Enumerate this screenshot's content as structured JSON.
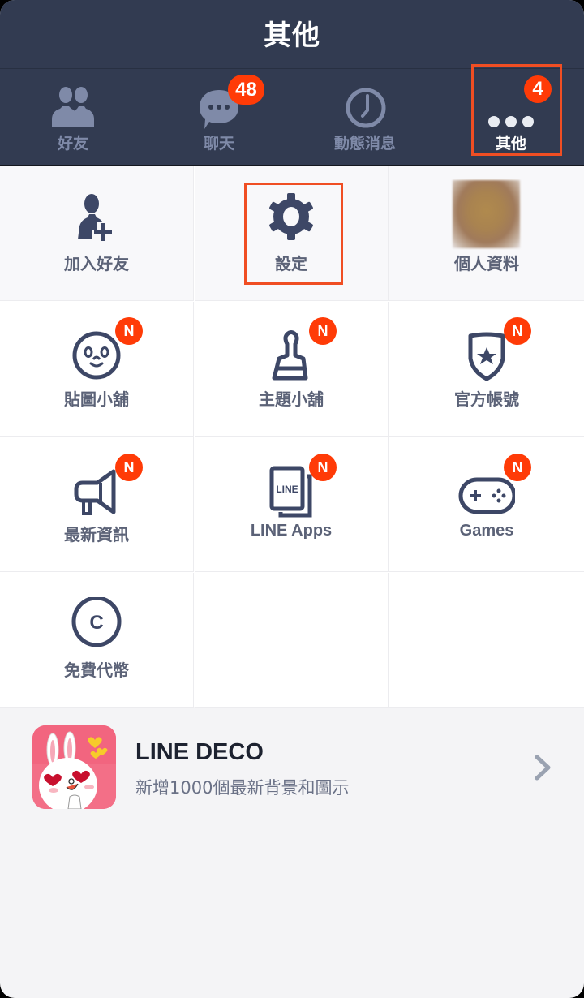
{
  "header": {
    "title": "其他"
  },
  "tabs": [
    {
      "label": "好友",
      "icon": "friends-icon",
      "badge": null,
      "active": false
    },
    {
      "label": "聊天",
      "icon": "chat-bubble-icon",
      "badge": "48",
      "active": false
    },
    {
      "label": "動態消息",
      "icon": "clock-icon",
      "badge": null,
      "active": false
    },
    {
      "label": "其他",
      "icon": "more-dots-icon",
      "badge": "4",
      "active": true
    }
  ],
  "grid": {
    "items": [
      {
        "label": "加入好友",
        "icon": "add-friend-icon",
        "new_badge": null
      },
      {
        "label": "設定",
        "icon": "gear-icon",
        "new_badge": null
      },
      {
        "label": "個人資料",
        "icon": "profile-photo",
        "new_badge": null
      },
      {
        "label": "貼圖小舖",
        "icon": "sticker-face-icon",
        "new_badge": "N"
      },
      {
        "label": "主題小舖",
        "icon": "paint-brush-icon",
        "new_badge": "N"
      },
      {
        "label": "官方帳號",
        "icon": "shield-star-icon",
        "new_badge": "N"
      },
      {
        "label": "最新資訊",
        "icon": "megaphone-icon",
        "new_badge": "N"
      },
      {
        "label": "LINE Apps",
        "icon": "line-apps-icon",
        "new_badge": "N"
      },
      {
        "label": "Games",
        "icon": "gamepad-icon",
        "new_badge": "N"
      },
      {
        "label": "免費代幣",
        "icon": "coin-c-icon",
        "new_badge": null
      }
    ],
    "line_apps_icon_text": "LINE",
    "coin_icon_text": "C"
  },
  "banner": {
    "title": "LINE DECO",
    "subtitle": "新增1000個最新背景和圖示"
  },
  "colors": {
    "header_bg": "#323b51",
    "badge": "#ff3b07",
    "highlight": "#f04e23",
    "icon": "#3d4766",
    "tab_inactive": "#7f8aa8"
  }
}
